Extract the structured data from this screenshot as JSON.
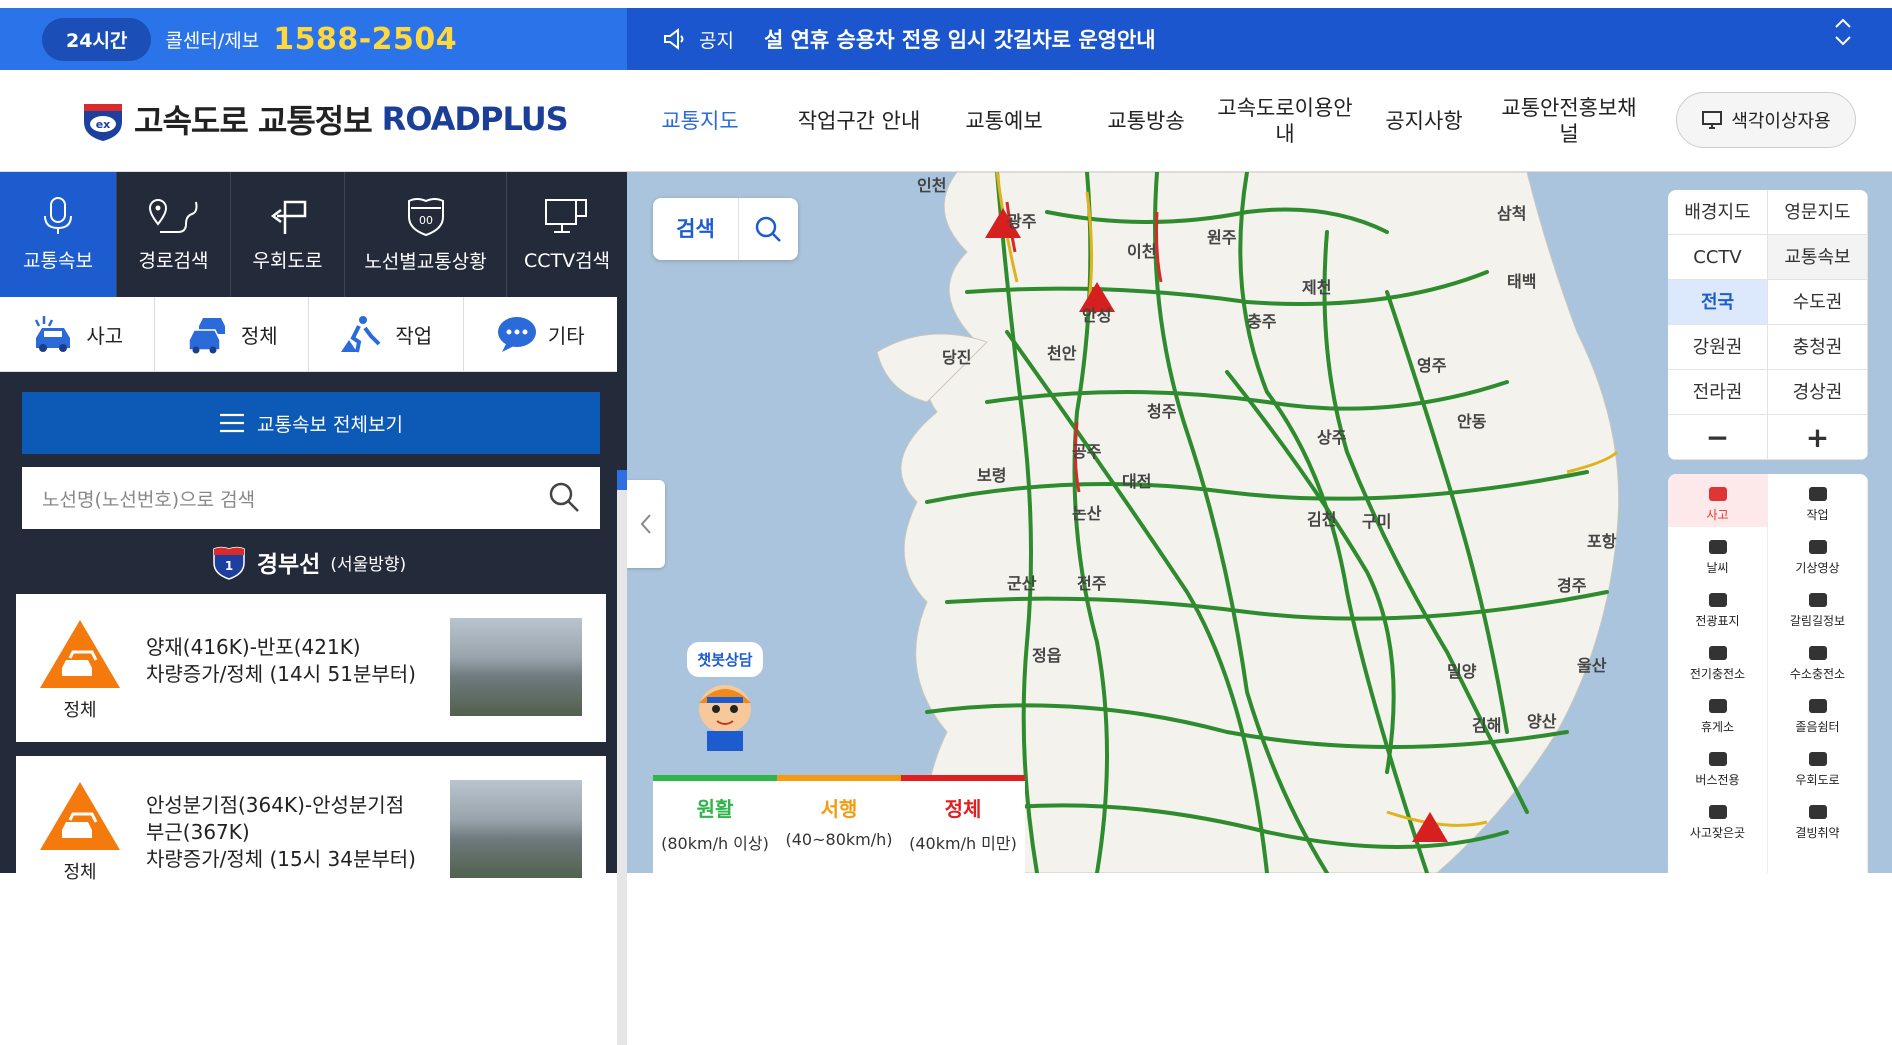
{
  "topbar": {
    "badge": "24시간",
    "callcenter_label": "콜센터/제보",
    "phone": "1588-2504",
    "notice_label": "공지",
    "notice_text": "설 연휴 승용차 전용 임시 갓길차로 운영안내"
  },
  "header": {
    "logo_text": "고속도로 교통정보",
    "logo_brand": "ROADPLUS",
    "nav": [
      {
        "label": "교통지도",
        "active": true
      },
      {
        "label": "작업구간 안내"
      },
      {
        "label": "교통예보"
      },
      {
        "label": "교통방송"
      },
      {
        "label": "고속도로이용안내"
      },
      {
        "label": "공지사항"
      },
      {
        "label": "교통안전홍보채널"
      }
    ],
    "colorblind_label": "색각이상자용"
  },
  "sidebar": {
    "tabs": [
      {
        "label": "교통속보",
        "icon": "microphone-icon"
      },
      {
        "label": "경로검색",
        "icon": "route-icon"
      },
      {
        "label": "우회도로",
        "icon": "detour-icon"
      },
      {
        "label": "노선별교통상황",
        "icon": "highway-shield-icon"
      },
      {
        "label": "CCTV검색",
        "icon": "cctv-icon"
      }
    ],
    "filters": [
      {
        "label": "사고",
        "icon": "accident-car-icon"
      },
      {
        "label": "정체",
        "icon": "congestion-cars-icon"
      },
      {
        "label": "작업",
        "icon": "roadwork-icon"
      },
      {
        "label": "기타",
        "icon": "chat-bubble-icon"
      }
    ],
    "all_button": "교통속보 전체보기",
    "search_placeholder": "노선명(노선번호)으로 검색",
    "route": {
      "number": "1",
      "name": "경부선",
      "direction": "(서울방향)"
    },
    "cards": [
      {
        "status": "정체",
        "lines": [
          "양재(416K)-반포(421K)",
          "차량증가/정체 (14시 51분부터)"
        ]
      },
      {
        "status": "정체",
        "lines": [
          "안성분기점(364K)-안성분기점",
          "부근(367K)",
          "차량증가/정체 (15시 34분부터)"
        ]
      }
    ]
  },
  "map": {
    "search_label": "검색",
    "chatbot_label": "챗봇상담",
    "legend": [
      {
        "label": "원활",
        "range": "(80km/h 이상)",
        "color": "#2fb54a"
      },
      {
        "label": "서행",
        "range": "(40~80km/h)",
        "color": "#f39c12"
      },
      {
        "label": "정체",
        "range": "(40km/h 미만)",
        "color": "#e02020"
      }
    ],
    "controls": [
      {
        "label": "배경지도",
        "lines": [
          "배경",
          "지도"
        ]
      },
      {
        "label": "영문지도",
        "lines": [
          "영문",
          "지도"
        ]
      },
      {
        "label": "CCTV",
        "lines": [
          "CCTV"
        ]
      },
      {
        "label": "교통속보",
        "lines": [
          "교통",
          "속보"
        ],
        "gray": true
      },
      {
        "label": "전국",
        "lines": [
          "전국"
        ],
        "active": true
      },
      {
        "label": "수도권",
        "lines": [
          "수도권"
        ]
      },
      {
        "label": "강원권",
        "lines": [
          "강원권"
        ]
      },
      {
        "label": "충청권",
        "lines": [
          "충청권"
        ]
      },
      {
        "label": "전라권",
        "lines": [
          "전라권"
        ]
      },
      {
        "label": "경상권",
        "lines": [
          "경상권"
        ]
      },
      {
        "label": "−",
        "lines": [
          "−"
        ],
        "sym": true
      },
      {
        "label": "+",
        "lines": [
          "+"
        ],
        "sym": true
      }
    ],
    "layers": [
      {
        "label": "사고",
        "icon": "accident-icon",
        "active": true
      },
      {
        "label": "작업",
        "icon": "roadwork-icon"
      },
      {
        "label": "날씨",
        "icon": "weather-icon"
      },
      {
        "label": "기상영상",
        "icon": "weather-video-icon"
      },
      {
        "label": "전광표지",
        "icon": "vms-icon"
      },
      {
        "label": "갈림길정보",
        "icon": "junction-icon"
      },
      {
        "label": "전기충전소",
        "icon": "ev-charger-icon"
      },
      {
        "label": "수소충전소",
        "icon": "hydrogen-station-icon"
      },
      {
        "label": "휴게소",
        "icon": "rest-area-icon"
      },
      {
        "label": "졸음쉼터",
        "icon": "parking-icon"
      },
      {
        "label": "버스전용",
        "icon": "bus-lane-icon"
      },
      {
        "label": "우회도로",
        "icon": "detour-icon"
      },
      {
        "label": "사고잦은곳",
        "icon": "accident-prone-icon"
      },
      {
        "label": "결빙취약",
        "icon": "ice-icon"
      },
      {
        "label": "",
        "icon": "tunnel-icon"
      },
      {
        "label": "",
        "icon": "cctv-icon"
      }
    ],
    "cities": [
      "인천",
      "광주",
      "이천",
      "원주",
      "삼척",
      "제천",
      "태백",
      "충주",
      "당진",
      "천안",
      "안성",
      "영주",
      "청주",
      "안동",
      "보령",
      "공주",
      "대전",
      "상주",
      "논산",
      "김천",
      "구미",
      "포항",
      "군산",
      "전주",
      "경주",
      "정읍",
      "울산",
      "밀양",
      "김해",
      "양산"
    ]
  }
}
